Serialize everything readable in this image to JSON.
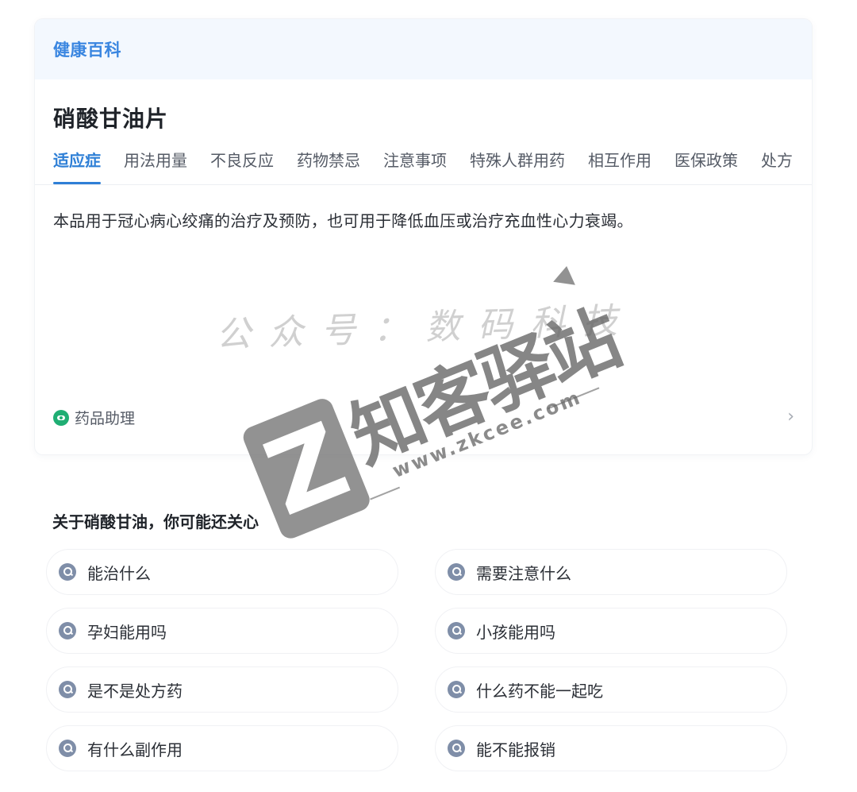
{
  "header": {
    "tag": "健康百科"
  },
  "drug": {
    "name": "硝酸甘油片"
  },
  "tabs": [
    {
      "label": "适应症",
      "active": true
    },
    {
      "label": "用法用量"
    },
    {
      "label": "不良反应"
    },
    {
      "label": "药物禁忌"
    },
    {
      "label": "注意事项"
    },
    {
      "label": "特殊人群用药"
    },
    {
      "label": "相互作用"
    },
    {
      "label": "医保政策"
    },
    {
      "label": "处方"
    }
  ],
  "content": {
    "indication": "本品用于冠心病心绞痛的治疗及预防，也可用于降低血压或治疗充血性心力衰竭。"
  },
  "assistant": {
    "label": "药品助理",
    "chevron": "›"
  },
  "related": {
    "title": "关于硝酸甘油，你可能还关心",
    "items": [
      "能治什么",
      "需要注意什么",
      "孕妇能用吗",
      "小孩能用吗",
      "是不是处方药",
      "什么药不能一起吃",
      "有什么副作用",
      "能不能报销"
    ]
  },
  "watermark": {
    "caption": "公众号：数码科技",
    "brand": "知客驿站",
    "url": "www.zkcee.com",
    "logo_letter": "Z"
  },
  "colors": {
    "accent": "#2e7fd6",
    "header_bg": "#f3f8fe",
    "assistant_icon": "#1fae73",
    "search_icon": "#7f8ea8"
  }
}
